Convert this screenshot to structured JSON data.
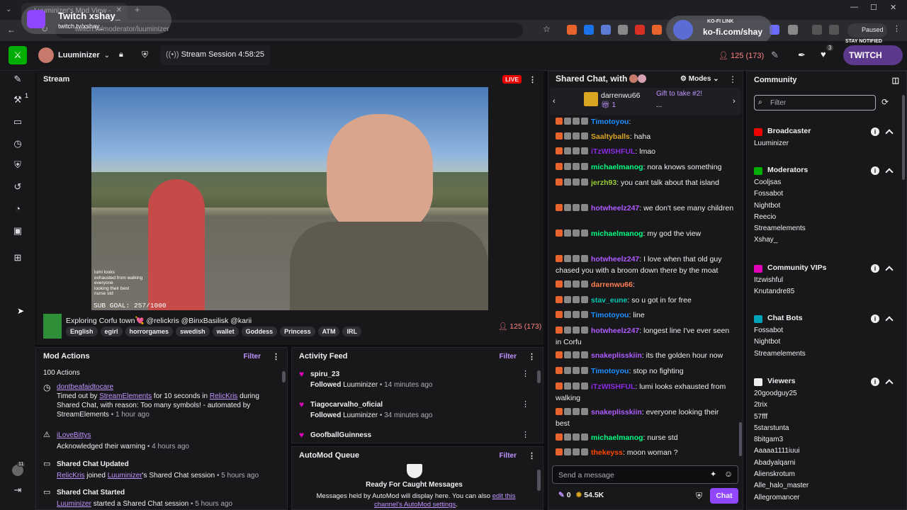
{
  "browser": {
    "tab_title": "Luuminizer's Mod View - T",
    "url": "twitch.tv/moderator/luuminizer",
    "profile_label": "Paused",
    "overlay_name": "Twitch xshay_",
    "overlay_handle": "twitch.tv/xshay_",
    "kofi_label": "KO-FI LINK",
    "kofi_url": "ko-fi.com/shay",
    "stay_notified": "STAY NOTIFIED",
    "twitch_label": "TWITCH"
  },
  "topnav": {
    "channel_name": "Luuminizer",
    "stream_session": "Stream Session 4:58:25",
    "viewer_count": "125 (173)",
    "notif_count": "3"
  },
  "left_rail": {
    "badge_count": "1",
    "avatar_count": "11"
  },
  "stream": {
    "header": "Stream",
    "live_label": "LIVE",
    "sub_goal": "SUB GOAL: 257/1000",
    "title": "Exploring Corfu town💘 @relickris @BinxBasilisk @karii",
    "tags": [
      "English",
      "egirl",
      "horrorgames",
      "swedish",
      "wallet",
      "Goddess",
      "Princess",
      "ATM",
      "IRL"
    ],
    "viewer_count": "125 (173)",
    "overlay_chat": [
      "lumi looks",
      "exhausted from walking",
      "everyone",
      "looking their best",
      "nurse std"
    ]
  },
  "mod_actions": {
    "header": "Mod Actions",
    "filter_label": "Filter",
    "count": "100 Actions",
    "entries": [
      {
        "user": "dontbeafaidtocare",
        "pre": "Timed out by ",
        "by": "StreamElements",
        "mid": " for 10 seconds in ",
        "channel": "RelicKris",
        "post": " during Shared Chat, with reason: Too many symbols! - automated by StreamElements",
        "time": "• 1 hour ago"
      },
      {
        "user": "iLoveBittys",
        "text": "Acknowledged their warning",
        "time": "• 4 hours ago"
      },
      {
        "title": "Shared Chat Updated",
        "user": "RelicKris",
        "mid": " joined ",
        "channel": "Luuminizer",
        "post": "'s Shared Chat session",
        "time": "• 5 hours ago"
      },
      {
        "title": "Shared Chat Started",
        "user": "Luuminizer",
        "post": " started a Shared Chat session",
        "time": "• 5 hours ago"
      }
    ]
  },
  "activity_feed": {
    "header": "Activity Feed",
    "filter_label": "Filter",
    "items": [
      {
        "user": "spiru_23",
        "action": "Followed",
        "target": "Luuminizer",
        "time": "• 14 minutes ago"
      },
      {
        "user": "Tiagocarvalho_oficial",
        "action": "Followed",
        "target": "Luuminizer",
        "time": "• 34 minutes ago"
      },
      {
        "user": "GoofballGuinness",
        "action": "",
        "target": "",
        "time": ""
      }
    ]
  },
  "automod": {
    "header": "AutoMod Queue",
    "filter_label": "Filter",
    "title": "Ready For Caught Messages",
    "body": "Messages held by AutoMod will display here. You can also",
    "link": "edit this channel's AutoMod settings",
    "link_end": "."
  },
  "chat": {
    "header": "Shared Chat, with",
    "modes_label": "Modes",
    "pinned_user": "darrenwu66",
    "pinned_count": "1",
    "pinned_text": "Gift to take #2!",
    "pinned_ellipsis": "...",
    "input_placeholder": "Send a message",
    "points": "0",
    "bits": "54.5K",
    "chat_button": "Chat",
    "messages": [
      {
        "user": "Timotoyou",
        "color": "#1e90ff",
        "text": ""
      },
      {
        "user": "Saaltyballs",
        "color": "#daa520",
        "text": "haha"
      },
      {
        "user": "iTzWISHFUL",
        "color": "#8a2be2",
        "text": "lmao"
      },
      {
        "user": "michaelmanog",
        "color": "#00ff7f",
        "text": "nora knows something"
      },
      {
        "user": "jerzh93",
        "color": "#9acd32",
        "text": "you cant talk about that island"
      },
      {
        "user": "hotwheelz247",
        "color": "#b05cff",
        "text": "we  don't see many children"
      },
      {
        "user": "michaelmanog",
        "color": "#00ff7f",
        "text": "my god the view"
      },
      {
        "user": "hotwheelz247",
        "color": "#b05cff",
        "text": "I love when that old guy chased you with a broom down there by the moat"
      },
      {
        "user": "darrenwu66",
        "color": "#ff7f50",
        "text": ""
      },
      {
        "user": "stav_eune",
        "color": "#00c8af",
        "text": "so u got in for free"
      },
      {
        "user": "Timotoyou",
        "color": "#1e90ff",
        "text": "line"
      },
      {
        "user": "hotwheelz247",
        "color": "#b05cff",
        "text": "longest line I've ever seen in Corfu"
      },
      {
        "user": "snakeplisskiin",
        "color": "#b05cff",
        "text": "its the golden hour now"
      },
      {
        "user": "Timotoyou",
        "color": "#1e90ff",
        "text": "stop no fighting"
      },
      {
        "user": "iTzWISHFUL",
        "color": "#8a2be2",
        "text": "lumi looks exhausted from walking"
      },
      {
        "user": "snakeplisskiin",
        "color": "#b05cff",
        "text": "everyone looking their best"
      },
      {
        "user": "michaelmanog",
        "color": "#00ff7f",
        "text": "nurse std"
      },
      {
        "user": "thekeyss",
        "color": "#ff4500",
        "text": "moon woman ?"
      }
    ]
  },
  "community": {
    "header": "Community",
    "filter_placeholder": "Filter",
    "sections": [
      {
        "title": "Broadcaster",
        "color": "#eb0400",
        "users": [
          "Luuminizer"
        ]
      },
      {
        "title": "Moderators",
        "color": "#00ad03",
        "users": [
          "Cooljsas",
          "Fossabot",
          "Nightbot",
          "Reecio",
          "Streamelements",
          "Xshay_"
        ]
      },
      {
        "title": "Community VIPs",
        "color": "#e005b9",
        "users": [
          "Itzwishful",
          "Knutandre85"
        ]
      },
      {
        "title": "Chat Bots",
        "color": "#00a3b8",
        "users": [
          "Fossabot",
          "Nightbot",
          "Streamelements"
        ]
      },
      {
        "title": "Viewers",
        "color": "#efeff1",
        "users": [
          "20goodguy25",
          "2trix",
          "57fff",
          "5starstunta",
          "8bitgam3",
          "Aaaaa1111iuui",
          "Abadyalqarni",
          "Alienskrotum",
          "Alle_halo_master",
          "Allegromancer"
        ]
      }
    ]
  }
}
